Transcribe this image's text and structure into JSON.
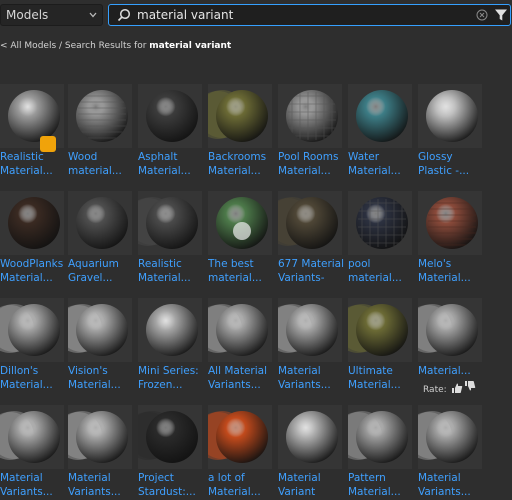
{
  "topbar": {
    "category": "Models",
    "search_value": "material variant"
  },
  "breadcrumb": {
    "back": "< All Models",
    "separator": " / ",
    "prefix": "Search Results for ",
    "query": "material variant"
  },
  "rate_label": "Rate:",
  "items": [
    {
      "line1": "Realistic",
      "line2": "Material...",
      "sphere": "#9a9a9a",
      "style": "gloss"
    },
    {
      "line1": "Wood",
      "line2": "material...",
      "sphere": "#8e8e8e",
      "style": "wood"
    },
    {
      "line1": "Asphalt",
      "line2": "Material...",
      "sphere": "#3c3c3c",
      "style": "matte"
    },
    {
      "line1": "Backrooms",
      "line2": "Material...",
      "sphere": "#6b6a35",
      "style": "stack"
    },
    {
      "line1": "Pool Rooms",
      "line2": "Material...",
      "sphere": "#8d8d8d",
      "style": "tiles"
    },
    {
      "line1": "Water",
      "line2": "Material...",
      "sphere": "#3d7d86",
      "style": "water"
    },
    {
      "line1": "Glossy",
      "line2": "Plastic -...",
      "sphere": "#bdbdbd",
      "style": "gloss"
    },
    {
      "line1": "WoodPlanks",
      "line2": "Material...",
      "sphere": "#3a2a22",
      "style": "dark"
    },
    {
      "line1": "Aquarium",
      "line2": "Gravel...",
      "sphere": "#4e4e4e",
      "style": "matte"
    },
    {
      "line1": "Realistic",
      "line2": "Material...",
      "sphere": "#4a4a4a",
      "style": "stack"
    },
    {
      "line1": "The best",
      "line2": "material...",
      "sphere": "#4d7a4a",
      "style": "photo"
    },
    {
      "line1": "677 Material",
      "line2": "Variants-",
      "sphere": "#4e4636",
      "style": "stack"
    },
    {
      "line1": "pool",
      "line2": "material...",
      "sphere": "#2c3140",
      "style": "tiles"
    },
    {
      "line1": "Melo's",
      "line2": "Material...",
      "sphere": "#8a4a3a",
      "style": "brick"
    },
    {
      "line1": "Dillon's",
      "line2": "Material...",
      "sphere": "#a0a0a0",
      "style": "stack"
    },
    {
      "line1": "Vision's",
      "line2": "Material...",
      "sphere": "#a3a3a3",
      "style": "stack"
    },
    {
      "line1": "Mini Series:",
      "line2": "Frozen...",
      "sphere": "#a5a5a5",
      "style": "gloss"
    },
    {
      "line1": "All Material",
      "line2": "Variants...",
      "sphere": "#9f9f9f",
      "style": "stack"
    },
    {
      "line1": "Material",
      "line2": "Variants...",
      "sphere": "#a2a2a2",
      "style": "stack"
    },
    {
      "line1": "Ultimate",
      "line2": "Material...",
      "sphere": "#6b6a35",
      "style": "stack"
    },
    {
      "line1": "Material...",
      "line2": "",
      "sphere": "#a0a0a0",
      "style": "stack"
    },
    {
      "line1": "Material",
      "line2": "Variants...",
      "sphere": "#a0a0a0",
      "style": "stack"
    },
    {
      "line1": "Material",
      "line2": "Variants...",
      "sphere": "#a3a3a3",
      "style": "stack"
    },
    {
      "line1": "Project",
      "line2": "Stardust:...",
      "sphere": "#2a2a2a",
      "style": "stack"
    },
    {
      "line1": "a lot of",
      "line2": "Material...",
      "sphere": "#c24a1c",
      "style": "stack"
    },
    {
      "line1": "Material",
      "line2": "Variant",
      "sphere": "#b0b0b0",
      "style": "gloss"
    },
    {
      "line1": "Pattern",
      "line2": "Material...",
      "sphere": "#9a9a9a",
      "style": "stack"
    },
    {
      "line1": "Material",
      "line2": "Variants...",
      "sphere": "#a0a0a0",
      "style": "stack"
    }
  ]
}
